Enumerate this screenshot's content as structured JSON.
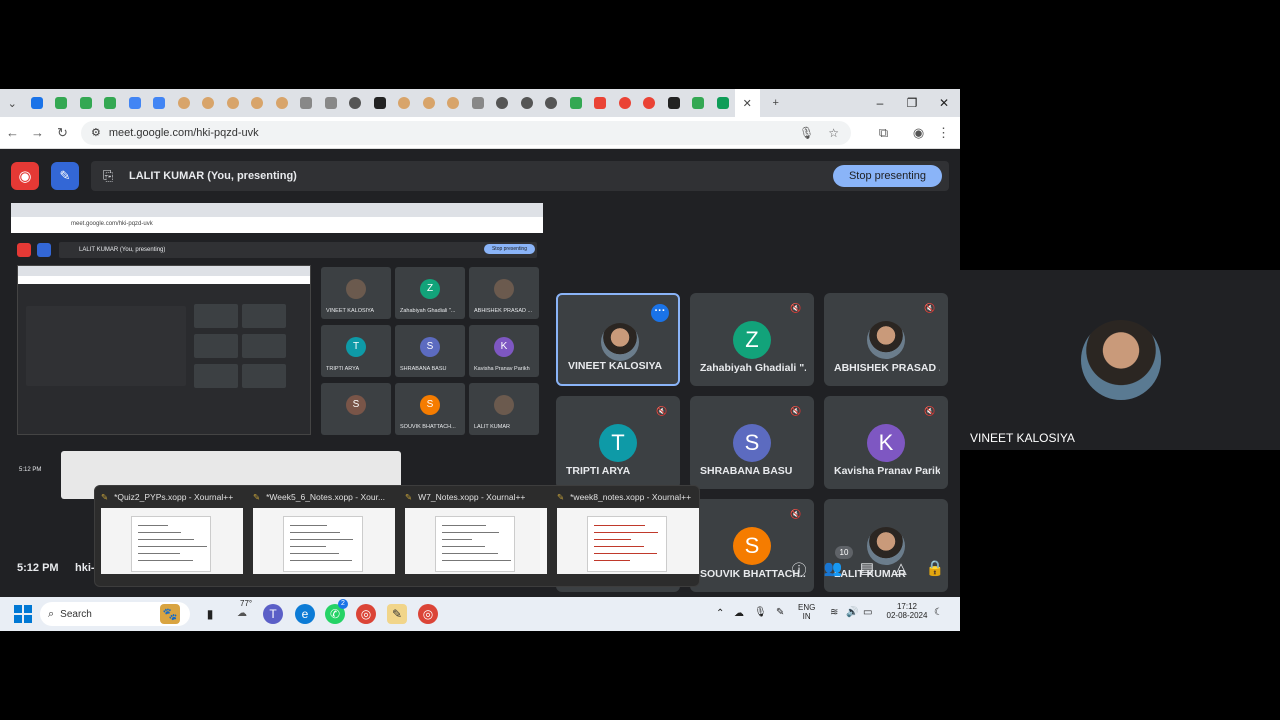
{
  "browser": {
    "url": "meet.google.com/hki-pqzd-uvk",
    "tab_icons": [
      "s",
      "drive",
      "drive",
      "drive",
      "docs",
      "docs",
      "face",
      "face",
      "face",
      "face",
      "face",
      "arrow",
      "arrow",
      "globe",
      "github",
      "face",
      "face",
      "face",
      "arrow",
      "globe",
      "globe",
      "globe",
      "green",
      "gmail",
      "circle",
      "circle",
      "github",
      "green",
      "sheets",
      "close"
    ]
  },
  "meet": {
    "presenting_label": "LALIT KUMAR (You, presenting)",
    "stop_presenting": "Stop presenting",
    "clock": "5:12 PM",
    "meeting_code_partial": "hki-",
    "people_count": "10",
    "participants": [
      {
        "name": "VINEET KALOSIYA",
        "initial": "",
        "color": "",
        "photo": true,
        "active": true,
        "muted": false
      },
      {
        "name": "Zahabiyah Ghadiali \"...",
        "initial": "Z",
        "color": "#12a37a",
        "photo": false,
        "active": false,
        "muted": true
      },
      {
        "name": "ABHISHEK PRASAD ...",
        "initial": "",
        "color": "",
        "photo": true,
        "active": false,
        "muted": true
      },
      {
        "name": "TRIPTI ARYA",
        "initial": "T",
        "color": "#0e9aa7",
        "photo": false,
        "active": false,
        "muted": true
      },
      {
        "name": "SHRABANA BASU",
        "initial": "S",
        "color": "#5c6bc0",
        "photo": false,
        "active": false,
        "muted": true
      },
      {
        "name": "Kavisha Pranav Parikh",
        "initial": "K",
        "color": "#7e57c2",
        "photo": false,
        "active": false,
        "muted": true
      },
      {
        "name": "",
        "initial": "S",
        "color": "#795548",
        "photo": false,
        "active": false,
        "muted": false
      },
      {
        "name": "SOUVIK BHATTACH...",
        "initial": "S",
        "color": "#f57c00",
        "photo": false,
        "active": false,
        "muted": true
      },
      {
        "name": "LALIT KUMAR",
        "initial": "",
        "color": "",
        "photo": true,
        "active": false,
        "muted": false
      }
    ]
  },
  "taskbar_previews": [
    {
      "title": "*Quiz2_PYPs.xopp - Xournal++"
    },
    {
      "title": "*Week5_6_Notes.xopp - Xour..."
    },
    {
      "title": "W7_Notes.xopp - Xournal++"
    },
    {
      "title": "*week8_notes.xopp - Xournal++"
    }
  ],
  "taskbar": {
    "search_placeholder": "Search",
    "weather": "77°",
    "whatsapp_badge": "2",
    "lang_line1": "ENG",
    "lang_line2": "IN",
    "time": "17:12",
    "date": "02-08-2024"
  },
  "camera_panel": {
    "name": "VINEET KALOSIYA"
  },
  "mirror": {
    "url": "meet.google.com/hki-pqzd-uvk",
    "presenting_label": "LALIT KUMAR (You, presenting)",
    "stop_presenting": "Stop presenting",
    "clock": "5:12 PM"
  },
  "colors": {
    "meet_bg": "#202124",
    "tile_bg": "#3c4043",
    "accent_blue": "#8ab4f8",
    "record_red": "#e53935"
  }
}
